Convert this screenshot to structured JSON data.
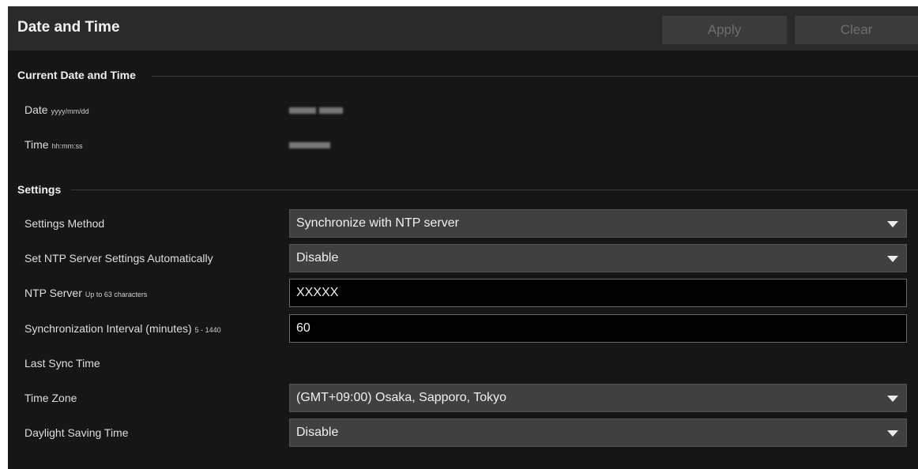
{
  "header": {
    "title": "Date and Time",
    "apply_label": "Apply",
    "clear_label": "Clear"
  },
  "current": {
    "section_title": "Current Date and Time",
    "date_label": "Date",
    "date_hint": "yyyy/mm/dd",
    "time_label": "Time",
    "time_hint": "hh:mm:ss"
  },
  "settings": {
    "section_title": "Settings",
    "method_label": "Settings Method",
    "method_value": "Synchronize with NTP server",
    "auto_label": "Set NTP Server Settings Automatically",
    "auto_value": "Disable",
    "ntp_label": "NTP Server",
    "ntp_hint": "Up to 63 characters",
    "ntp_value": "XXXXX",
    "interval_label": "Synchronization Interval (minutes)",
    "interval_hint": "5 - 1440",
    "interval_value": "60",
    "last_sync_label": "Last Sync Time",
    "timezone_label": "Time Zone",
    "timezone_value": "(GMT+09:00) Osaka, Sapporo, Tokyo",
    "dst_label": "Daylight Saving Time",
    "dst_value": "Disable"
  }
}
